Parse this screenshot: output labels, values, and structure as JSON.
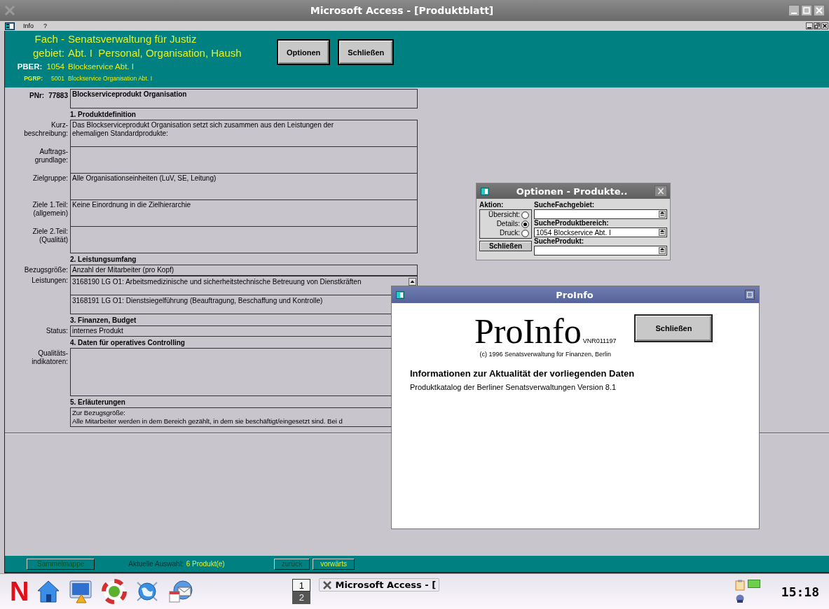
{
  "window": {
    "title": "Microsoft Access - [Produktblatt]"
  },
  "menu": [
    "Info",
    "?"
  ],
  "header": {
    "fach_label_1": "Fach -",
    "fach_label_2": "gebiet:",
    "fach_line_1": "Senatsverwaltung für Justiz",
    "fach_line_2": "Abt. I  Personal, Organisation, Haush",
    "pber_label": "PBER:",
    "pber_number": "1054",
    "pber_name": "Blockservice Abt. I",
    "pgrp_label": "PGRP:",
    "pgrp_number": "5001",
    "pgrp_name": "Blockservice Organisation Abt. I",
    "buttons": [
      "Optionen",
      "Schließen"
    ]
  },
  "form": {
    "pnr_label": "PNr:",
    "pnr": "77883",
    "title": "Blockserviceprodukt Organisation",
    "sections": [
      {
        "heading": "1. Produktdefinition",
        "fields": [
          {
            "label": "Kurz-\nbeschreibung:",
            "kind": "memo",
            "lines": [
              "Das Blockserviceprodukt Organisation setzt sich zusammen aus den Leistungen der",
              "ehemaligen Standardprodukte:"
            ]
          },
          {
            "label": "Auftrags-\ngrundlage:",
            "kind": "memo"
          },
          {
            "label": "Zielgruppe:",
            "kind": "memo",
            "lines": [
              "Alle Organisationseinheiten (LuV, SE, Leitung)"
            ]
          },
          {
            "label": "Ziele 1.Teil:\n(allgemein)",
            "kind": "memo",
            "lines": [
              "Keine Einordnung in die Zielhierarchie"
            ]
          },
          {
            "label": "Ziele 2.Teil:\n(Qualität)",
            "kind": "memo"
          }
        ]
      },
      {
        "heading": "2. Leistungsumfang",
        "fields": [
          {
            "label": "Bezugsgröße:",
            "kind": "line",
            "lines": [
              "Anzahl der Mitarbeiter (pro Kopf)"
            ]
          },
          {
            "label": "Leistungen:",
            "kind": "list",
            "lines": [
              "3168190 LG O1: Arbeitsmedizinische und sicherheitstechnische Betreuung von Dienstkräften",
              "3168191 LG O1: Dienstsiegelführung (Beauftragung, Beschaffung und Kontrolle)"
            ]
          }
        ]
      },
      {
        "heading": "3. Finanzen, Budget",
        "fields": [
          {
            "label": "Status:",
            "kind": "line",
            "lines": [
              "internes Produkt"
            ]
          }
        ]
      },
      {
        "heading": "4. Daten für operatives Controlling",
        "fields": [
          {
            "label": "Qualitäts-\nindikatoren:",
            "kind": "area"
          }
        ]
      },
      {
        "heading": "5. Erläuterungen",
        "fields": [
          {
            "kind": "short",
            "lines": [
              "Zur Bezugsgröße:",
              "Alle Mitarbeiter werden in dem Bereich gezählt, in dem sie beschäftigt/eingesetzt sind. Bei d"
            ]
          }
        ]
      }
    ]
  },
  "footer": {
    "collection_button": "Sammelmappe",
    "selection_label": "Aktuelle Auswahl:",
    "selection_value": "6 Produkt(e)",
    "nav": [
      {
        "label": "zurück",
        "enabled": false
      },
      {
        "label": "vorwärts",
        "enabled": true
      }
    ]
  },
  "options_dialog": {
    "title": "Optionen - Produkte..",
    "action_label": "Aktion:",
    "actions": [
      {
        "label": "Übersicht:",
        "selected": false
      },
      {
        "label": "Details:",
        "selected": true
      },
      {
        "label": "Druck:",
        "selected": false
      }
    ],
    "close_button": "Schließen",
    "searches": [
      {
        "label": "SucheFachgebiet:"
      },
      {
        "label": "SucheProduktbereich:",
        "value": "1054 Blockservice Abt. I"
      },
      {
        "label": "SucheProdukt:"
      }
    ]
  },
  "info_dialog": {
    "title": "ProInfo",
    "app_name": "ProInfo",
    "version": "VNR011197",
    "copyright": "(c) 1996 Senatsverwaltung für Finanzen, Berlin",
    "close_button": "Schließen",
    "heading": "Informationen zur Aktualität der vorliegenden Daten",
    "text": "Produktkatalog der Berliner Senatsverwaltungen Version 8.1"
  },
  "taskbar": {
    "logo": "N",
    "pager": [
      {
        "label": "1",
        "selected": true
      },
      {
        "label": "2",
        "selected": false
      }
    ],
    "task": "Microsoft Access - [",
    "clock": "15:18"
  }
}
